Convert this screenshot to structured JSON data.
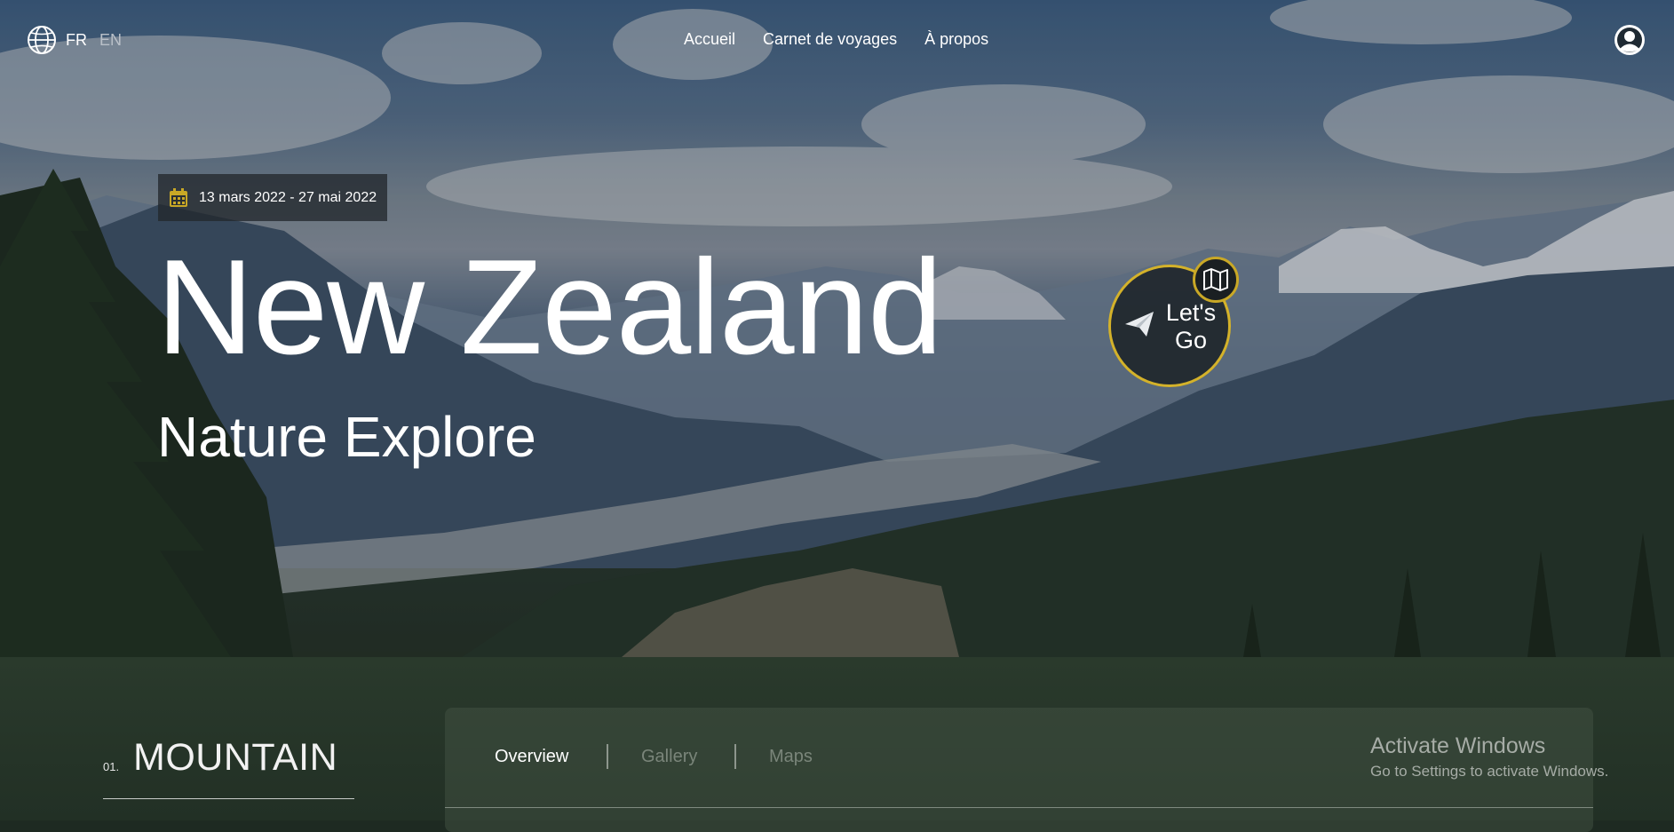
{
  "header": {
    "languages": {
      "active": "FR",
      "inactive": "EN"
    },
    "nav": [
      "Accueil",
      "Carnet de voyages",
      "À propos"
    ]
  },
  "hero": {
    "date_range": "13 mars 2022 - 27 mai 2022",
    "title": "New Zealand",
    "subtitle": "Nature Explore",
    "cta_label_line1": "Let's",
    "cta_label_line2": "Go"
  },
  "section": {
    "number": "01.",
    "title": "MOUNTAIN",
    "tabs": [
      "Overview",
      "Gallery",
      "Maps"
    ],
    "active_tab": "Overview"
  },
  "watermark": {
    "title": "Activate Windows",
    "subtitle": "Go to Settings to activate Windows."
  },
  "icons": {
    "globe": "globe-icon",
    "user": "user-circle-icon",
    "calendar": "calendar-icon",
    "plane": "paper-plane-icon",
    "map": "folded-map-icon"
  },
  "colors": {
    "accent": "#d4b22a",
    "panel": "#223025"
  }
}
